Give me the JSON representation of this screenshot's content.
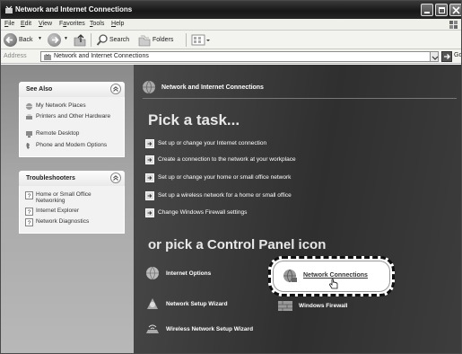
{
  "window": {
    "title": "Network and Internet Connections"
  },
  "menu": {
    "items": [
      {
        "pre": "",
        "key": "F",
        "post": "ile"
      },
      {
        "pre": "",
        "key": "E",
        "post": "dit"
      },
      {
        "pre": "",
        "key": "V",
        "post": "iew"
      },
      {
        "pre": "F",
        "key": "a",
        "post": "vorites"
      },
      {
        "pre": "",
        "key": "T",
        "post": "ools"
      },
      {
        "pre": "",
        "key": "H",
        "post": "elp"
      }
    ]
  },
  "toolbar": {
    "back_label": "Back",
    "search_label": "Search",
    "folders_label": "Folders"
  },
  "address": {
    "label": "Address",
    "value": "Network and Internet Connections",
    "go_label": "Go"
  },
  "see_also": {
    "title": "See Also",
    "items": [
      {
        "label": "My Network Places",
        "icon": "network-places-icon"
      },
      {
        "label": "Printers and Other Hardware",
        "icon": "printer-icon"
      },
      {
        "label": "Remote Desktop",
        "icon": "remote-desktop-icon"
      },
      {
        "label": "Phone and Modem Options",
        "icon": "phone-icon"
      }
    ]
  },
  "troubleshooters": {
    "title": "Troubleshooters",
    "items": [
      {
        "label": "Home or Small Office Networking",
        "icon": "help-icon"
      },
      {
        "label": "Internet Explorer",
        "icon": "help-icon"
      },
      {
        "label": "Network Diagnostics",
        "icon": "help-icon"
      }
    ]
  },
  "main": {
    "header": "Network and Internet Connections",
    "pick_task": "Pick a task...",
    "tasks": [
      "Set up or change your Internet connection",
      "Create a connection to the network at your workplace",
      "Set up or change your home or small office network",
      "Set up a wireless network for a home or small office",
      "Change Windows Firewall settings"
    ],
    "pick_icon": "or pick a Control Panel icon",
    "icons": {
      "internet_options": "Internet Options",
      "network_connections": "Network Connections",
      "network_setup_wizard": "Network Setup Wizard",
      "windows_firewall": "Windows Firewall",
      "wireless_wizard": "Wireless Network Setup Wizard"
    }
  }
}
